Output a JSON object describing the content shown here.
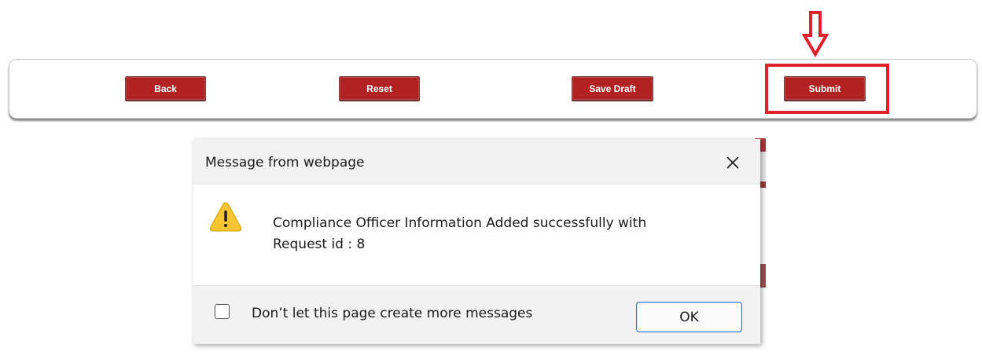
{
  "toolbar": {
    "back_label": "Back",
    "reset_label": "Reset",
    "save_draft_label": "Save Draft",
    "submit_label": "Submit"
  },
  "annotation": {
    "arrow_icon": "down-arrow-icon",
    "highlight_color": "#e0202b"
  },
  "dialog": {
    "title": "Message from webpage",
    "close_icon": "close-icon",
    "warning_icon": "warning-icon",
    "message_line1": "Compliance Officer Information Added successfully with",
    "message_line2": "Request id : 8",
    "checkbox_label": "Don’t let this page create more messages",
    "ok_label": "OK"
  },
  "colors": {
    "button_red": "#b22222",
    "annotation_red": "#e0202b",
    "ok_border": "#2f6fcf",
    "dialog_gray": "#f2f2f2"
  }
}
